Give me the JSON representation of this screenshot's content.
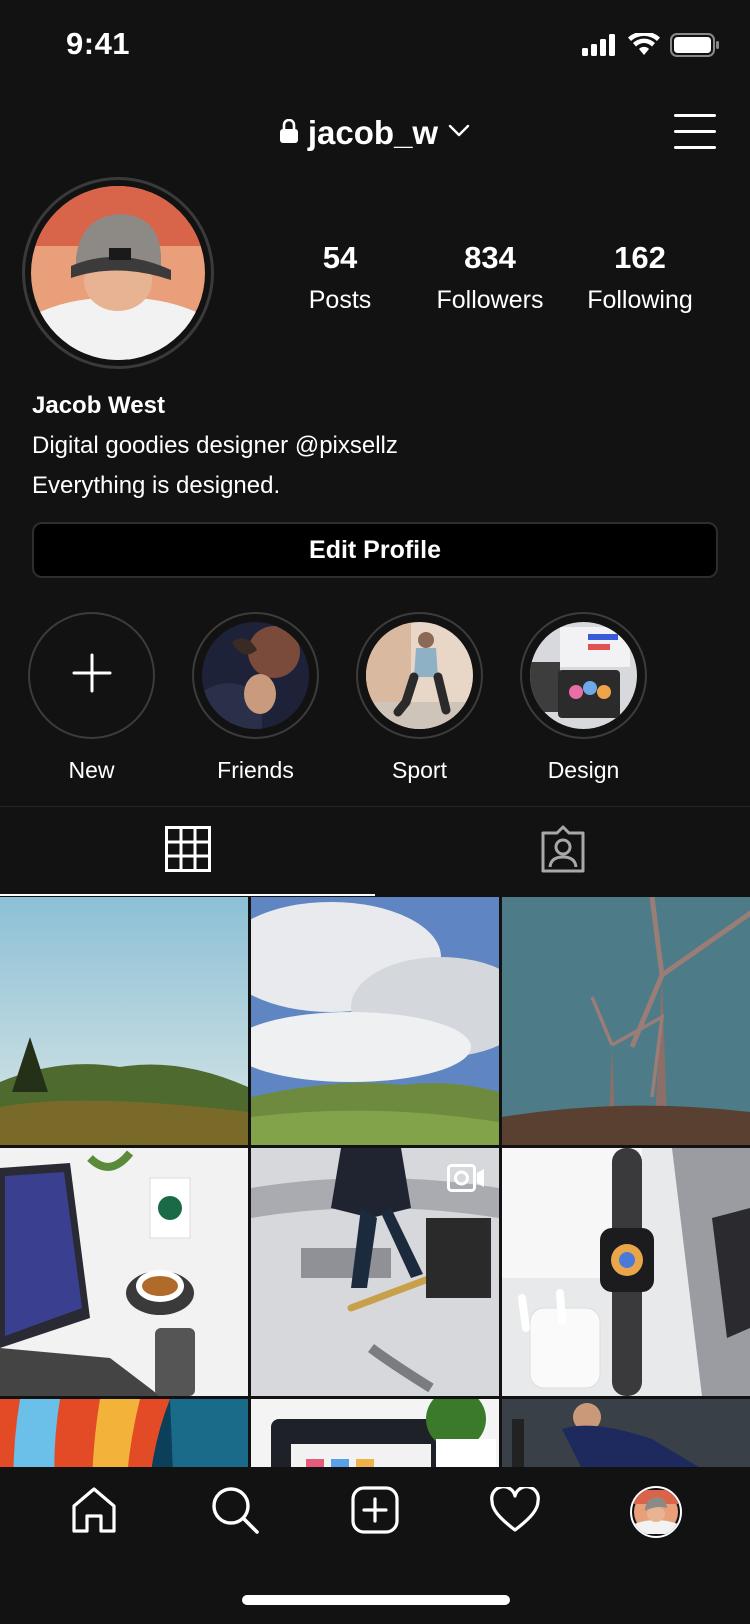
{
  "status_bar": {
    "time": "9:41"
  },
  "header": {
    "username": "jacob_w"
  },
  "profile": {
    "stats": [
      {
        "number": "54",
        "label": "Posts"
      },
      {
        "number": "834",
        "label": "Followers"
      },
      {
        "number": "162",
        "label": "Following"
      }
    ],
    "name": "Jacob West",
    "bio_lines": [
      "Digital goodies designer @pixsellz",
      "Everything is designed."
    ],
    "edit_button": "Edit Profile"
  },
  "highlights": [
    {
      "label": "New",
      "icon": "plus-icon"
    },
    {
      "label": "Friends"
    },
    {
      "label": "Sport"
    },
    {
      "label": "Design"
    }
  ],
  "tabs": [
    {
      "icon": "grid-icon",
      "active": true
    },
    {
      "icon": "tagged-icon",
      "active": false
    }
  ],
  "bottom_nav": [
    "home-icon",
    "search-icon",
    "add-post-icon",
    "heart-icon",
    "profile-avatar"
  ],
  "colors": {
    "background": "#121212",
    "text": "#ffffff",
    "border": "#2e2e2e"
  }
}
